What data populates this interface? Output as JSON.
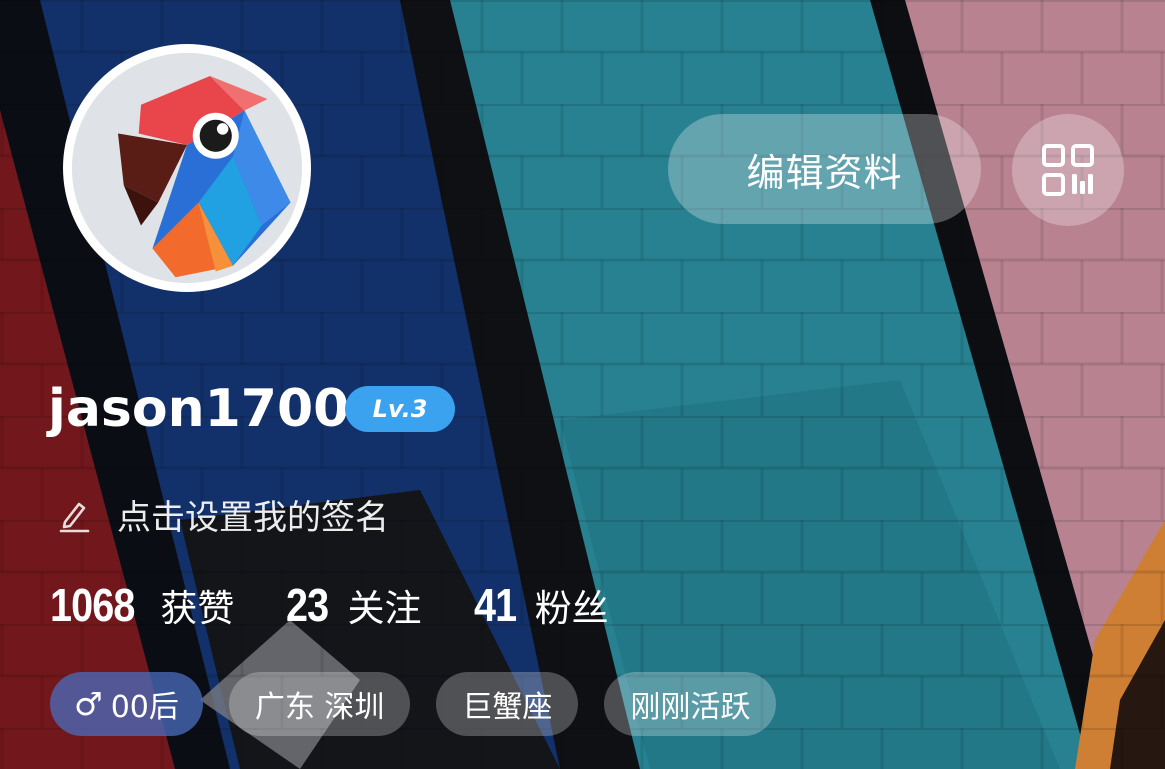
{
  "profile": {
    "username": "jason1700",
    "level": "Lv.3",
    "signature_prompt": "点击设置我的签名"
  },
  "header": {
    "edit_label": "编辑资料"
  },
  "stats": [
    {
      "value": "1068",
      "label": "获赞"
    },
    {
      "value": "23",
      "label": "关注"
    },
    {
      "value": "41",
      "label": "粉丝"
    }
  ],
  "tags": {
    "gender_symbol": "♂",
    "age": "00后",
    "location": "广东 深圳",
    "zodiac": "巨蟹座",
    "activity": "刚刚活跃"
  },
  "icons": {
    "qr": "qr-code-icon",
    "edit_signature": "pencil-icon",
    "avatar": "parrot-avatar"
  },
  "colors": {
    "level_badge": "#3aa2ef",
    "gender_tag": "#4b6ebe"
  }
}
